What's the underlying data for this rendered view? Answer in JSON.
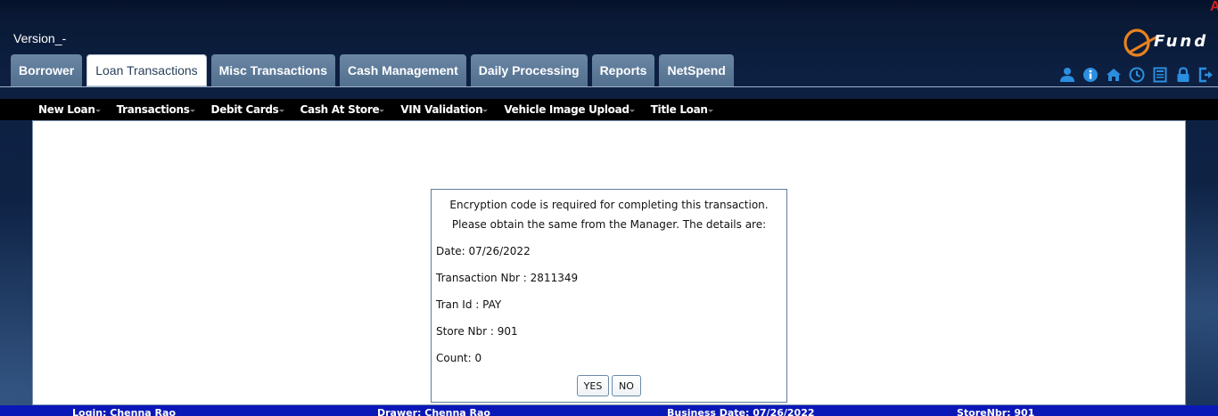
{
  "app": {
    "version_label": "Version_-",
    "logo_text": "Fund",
    "corner_mark": "A"
  },
  "tabs": [
    {
      "label": "Borrower",
      "active": false
    },
    {
      "label": "Loan Transactions",
      "active": true
    },
    {
      "label": "Misc Transactions",
      "active": false
    },
    {
      "label": "Cash Management",
      "active": false
    },
    {
      "label": "Daily Processing",
      "active": false
    },
    {
      "label": "Reports",
      "active": false
    },
    {
      "label": "NetSpend",
      "active": false
    }
  ],
  "header_icons": [
    "user-icon",
    "info-icon",
    "home-icon",
    "clock-icon",
    "calculator-icon",
    "lock-icon",
    "logout-icon"
  ],
  "menu": [
    {
      "label": "New Loan",
      "has_dropdown": true
    },
    {
      "label": "Transactions",
      "has_dropdown": true
    },
    {
      "label": "Debit Cards",
      "has_dropdown": true
    },
    {
      "label": "Cash At Store",
      "has_dropdown": true
    },
    {
      "label": "VIN Validation",
      "has_dropdown": true
    },
    {
      "label": "Vehicle Image Upload",
      "has_dropdown": true
    },
    {
      "label": "Title Loan",
      "has_dropdown": true
    }
  ],
  "dialog": {
    "line1": "Encryption code is required for completing this transaction.",
    "line2": "Please obtain the same from the Manager. The details are:",
    "date": "Date: 07/26/2022",
    "transaction_nbr": "Transaction Nbr : 2811349",
    "tran_id": "Tran Id : PAY",
    "store_nbr": "Store Nbr : 901",
    "count": "Count: 0",
    "yes_label": "YES",
    "no_label": "NO"
  },
  "footer": {
    "login": "Login: Chenna Rao",
    "drawer": "Drawer: Chenna Rao",
    "business_date": "Business Date: 07/26/2022",
    "store": "StoreNbr: 901"
  },
  "colors": {
    "background": "#0e2346",
    "tab": "#5e7b99",
    "menubar": "#000000",
    "footer": "#0b18b8",
    "logo_orange": "#e8821e"
  }
}
